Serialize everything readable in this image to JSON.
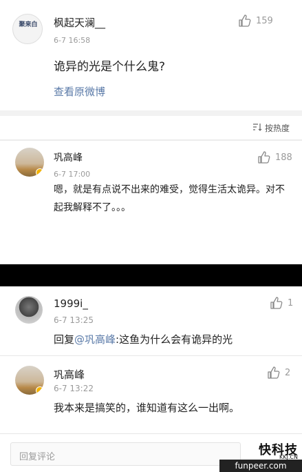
{
  "original_post": {
    "user": "枫起天澜__",
    "time": "6-7 16:58",
    "likes": "159",
    "text": "诡异的光是个什么鬼?",
    "view_original": "查看原微博",
    "avatar_text": "聚来白"
  },
  "sort": {
    "label": "按热度"
  },
  "comment1": {
    "user": "巩高峰",
    "time": "6-7 17:00",
    "likes": "188",
    "text": "嗯，就是有点说不出来的难受，觉得生活太诡异。对不起我解释不了。。。"
  },
  "comment2": {
    "user": "1999i_",
    "time": "6-7 13:25",
    "likes": "1",
    "reply_prefix": "回复",
    "mention": "@巩高峰",
    "text": ":这鱼为什么会有诡异的光"
  },
  "comment3": {
    "user": "巩高峰",
    "time": "6-7 13:22",
    "likes": "2",
    "text": "我本来是搞笑的，谁知道有这么一出啊。"
  },
  "reply_input": {
    "placeholder": "回复评论"
  },
  "watermark": {
    "logo": "快科技",
    "sub": "KKJ.CN",
    "url": "funpeer.com"
  },
  "icons": {
    "like": "thumbs-up-icon",
    "sort": "sort-icon"
  }
}
